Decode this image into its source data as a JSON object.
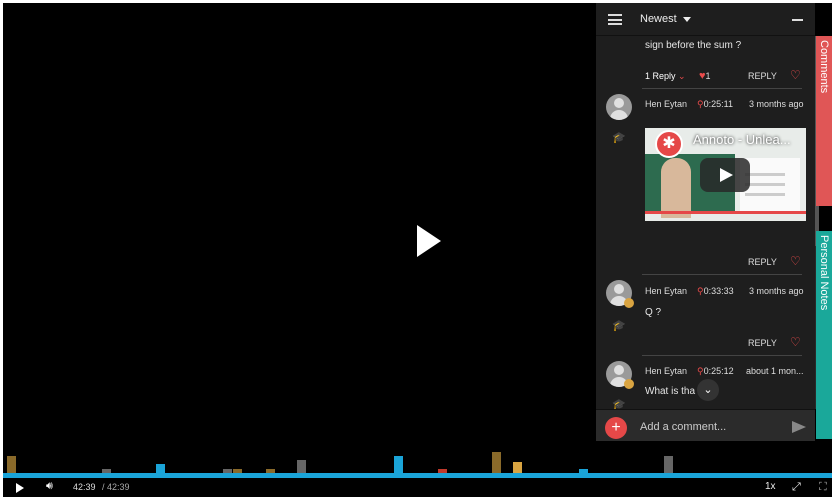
{
  "panel": {
    "sort_label": "Newest",
    "close_label": "✕"
  },
  "comments": [
    {
      "text": "sign before the sum ?",
      "replies_label": "1 Reply",
      "likes": "1",
      "reply_label": "REPLY"
    },
    {
      "author": "Hen Eytan",
      "timestamp": "0:25:11",
      "age": "3 months ago",
      "video_title": "Annoto - Unlea...",
      "reply_label": "REPLY"
    },
    {
      "author": "Hen Eytan",
      "timestamp": "0:33:33",
      "age": "3 months ago",
      "text": "Q ?",
      "reply_label": "REPLY"
    },
    {
      "author": "Hen Eytan",
      "timestamp": "0:25:12",
      "age": "about 1 mon...",
      "text": "What is tha"
    }
  ],
  "composer": {
    "placeholder": "Add a comment..."
  },
  "tabs": {
    "comments": "Comments",
    "notes": "Personal Notes"
  },
  "player": {
    "current_time": "42:39",
    "duration": "/ 42:39",
    "speed": "1x"
  },
  "timeline_markers": [
    {
      "pos": 0.005,
      "h": 18,
      "c": "#8a6a2a"
    },
    {
      "pos": 0.12,
      "h": 5,
      "c": "#666"
    },
    {
      "pos": 0.185,
      "h": 10,
      "c": "#1aa4d8"
    },
    {
      "pos": 0.265,
      "h": 5,
      "c": "#666"
    },
    {
      "pos": 0.278,
      "h": 5,
      "c": "#8a6a2a"
    },
    {
      "pos": 0.317,
      "h": 5,
      "c": "#8a6a2a"
    },
    {
      "pos": 0.355,
      "h": 14,
      "c": "#666"
    },
    {
      "pos": 0.472,
      "h": 18,
      "c": "#1aa4d8"
    },
    {
      "pos": 0.525,
      "h": 5,
      "c": "#c0392b"
    },
    {
      "pos": 0.59,
      "h": 22,
      "c": "#8a6a2a"
    },
    {
      "pos": 0.615,
      "h": 12,
      "c": "#d9a441"
    },
    {
      "pos": 0.695,
      "h": 5,
      "c": "#1aa4d8"
    },
    {
      "pos": 0.797,
      "h": 18,
      "c": "#666"
    }
  ]
}
